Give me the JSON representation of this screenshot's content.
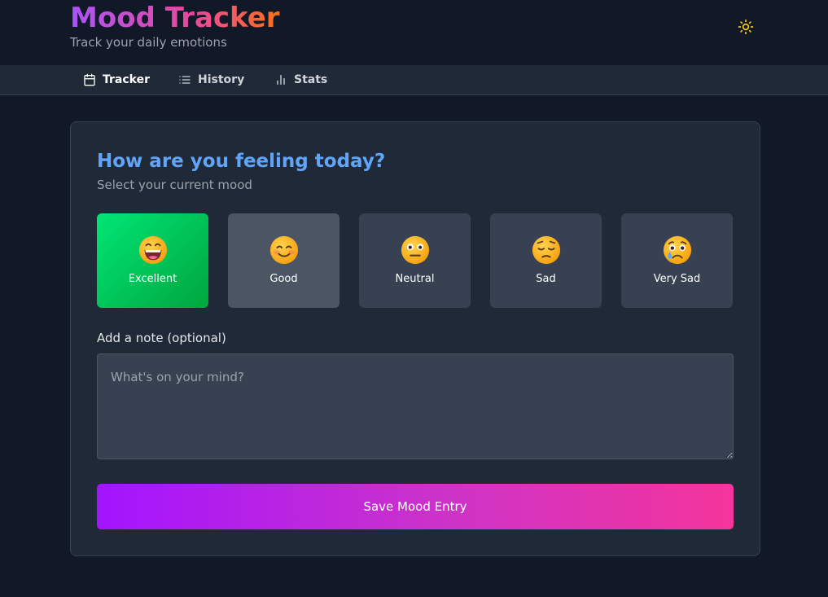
{
  "app": {
    "title": "Mood Tracker",
    "subtitle": "Track your daily emotions",
    "theme_toggle_icon": "sun-icon"
  },
  "nav": {
    "tabs": [
      {
        "label": "Tracker",
        "icon": "calendar-icon",
        "active": true
      },
      {
        "label": "History",
        "icon": "list-icon",
        "active": false
      },
      {
        "label": "Stats",
        "icon": "bar-chart-icon",
        "active": false
      }
    ]
  },
  "tracker": {
    "title": "How are you feeling today?",
    "subtitle": "Select your current mood",
    "moods": [
      {
        "label": "Excellent",
        "emoji": "grinning-face-icon",
        "selected": true
      },
      {
        "label": "Good",
        "emoji": "smiling-face-icon",
        "selected": false
      },
      {
        "label": "Neutral",
        "emoji": "neutral-face-icon",
        "selected": false
      },
      {
        "label": "Sad",
        "emoji": "pensive-face-icon",
        "selected": false
      },
      {
        "label": "Very Sad",
        "emoji": "crying-face-icon",
        "selected": false
      }
    ],
    "note_label": "Add a note (optional)",
    "note_placeholder": "What's on your mind?",
    "note_value": "",
    "save_label": "Save Mood Entry"
  },
  "colors": {
    "background": "#111827",
    "surface": "#1f2937",
    "accent_blue": "#60a5fa",
    "selected_green": "#00c853",
    "gradient_start": "#a314ff",
    "gradient_end": "#f4359b"
  }
}
